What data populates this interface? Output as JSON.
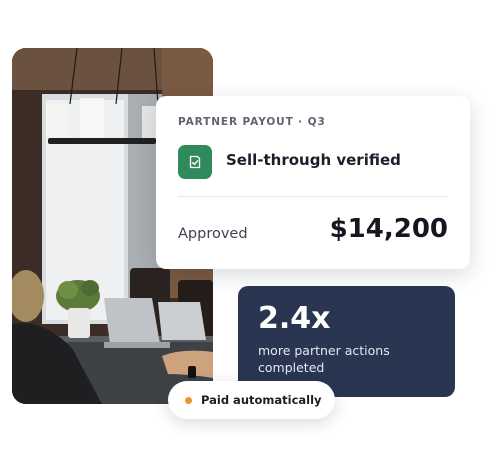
{
  "photo": {
    "alt": "people working on laptops at a table"
  },
  "payout_card": {
    "eyebrow": "PARTNER PAYOUT · Q3",
    "verified_label": "Sell-through verified",
    "status_label": "Approved",
    "amount": "$14,200"
  },
  "stat_card": {
    "value": "2.4x",
    "caption": "more partner actions completed"
  },
  "pill": {
    "label": "Paid automatically"
  },
  "colors": {
    "verified_green": "#2f8a5c",
    "stat_navy": "#293551",
    "dot_orange": "#f2922b"
  },
  "icons": {
    "verified": "check-badge-icon",
    "status_dot": "status-dot-icon"
  }
}
